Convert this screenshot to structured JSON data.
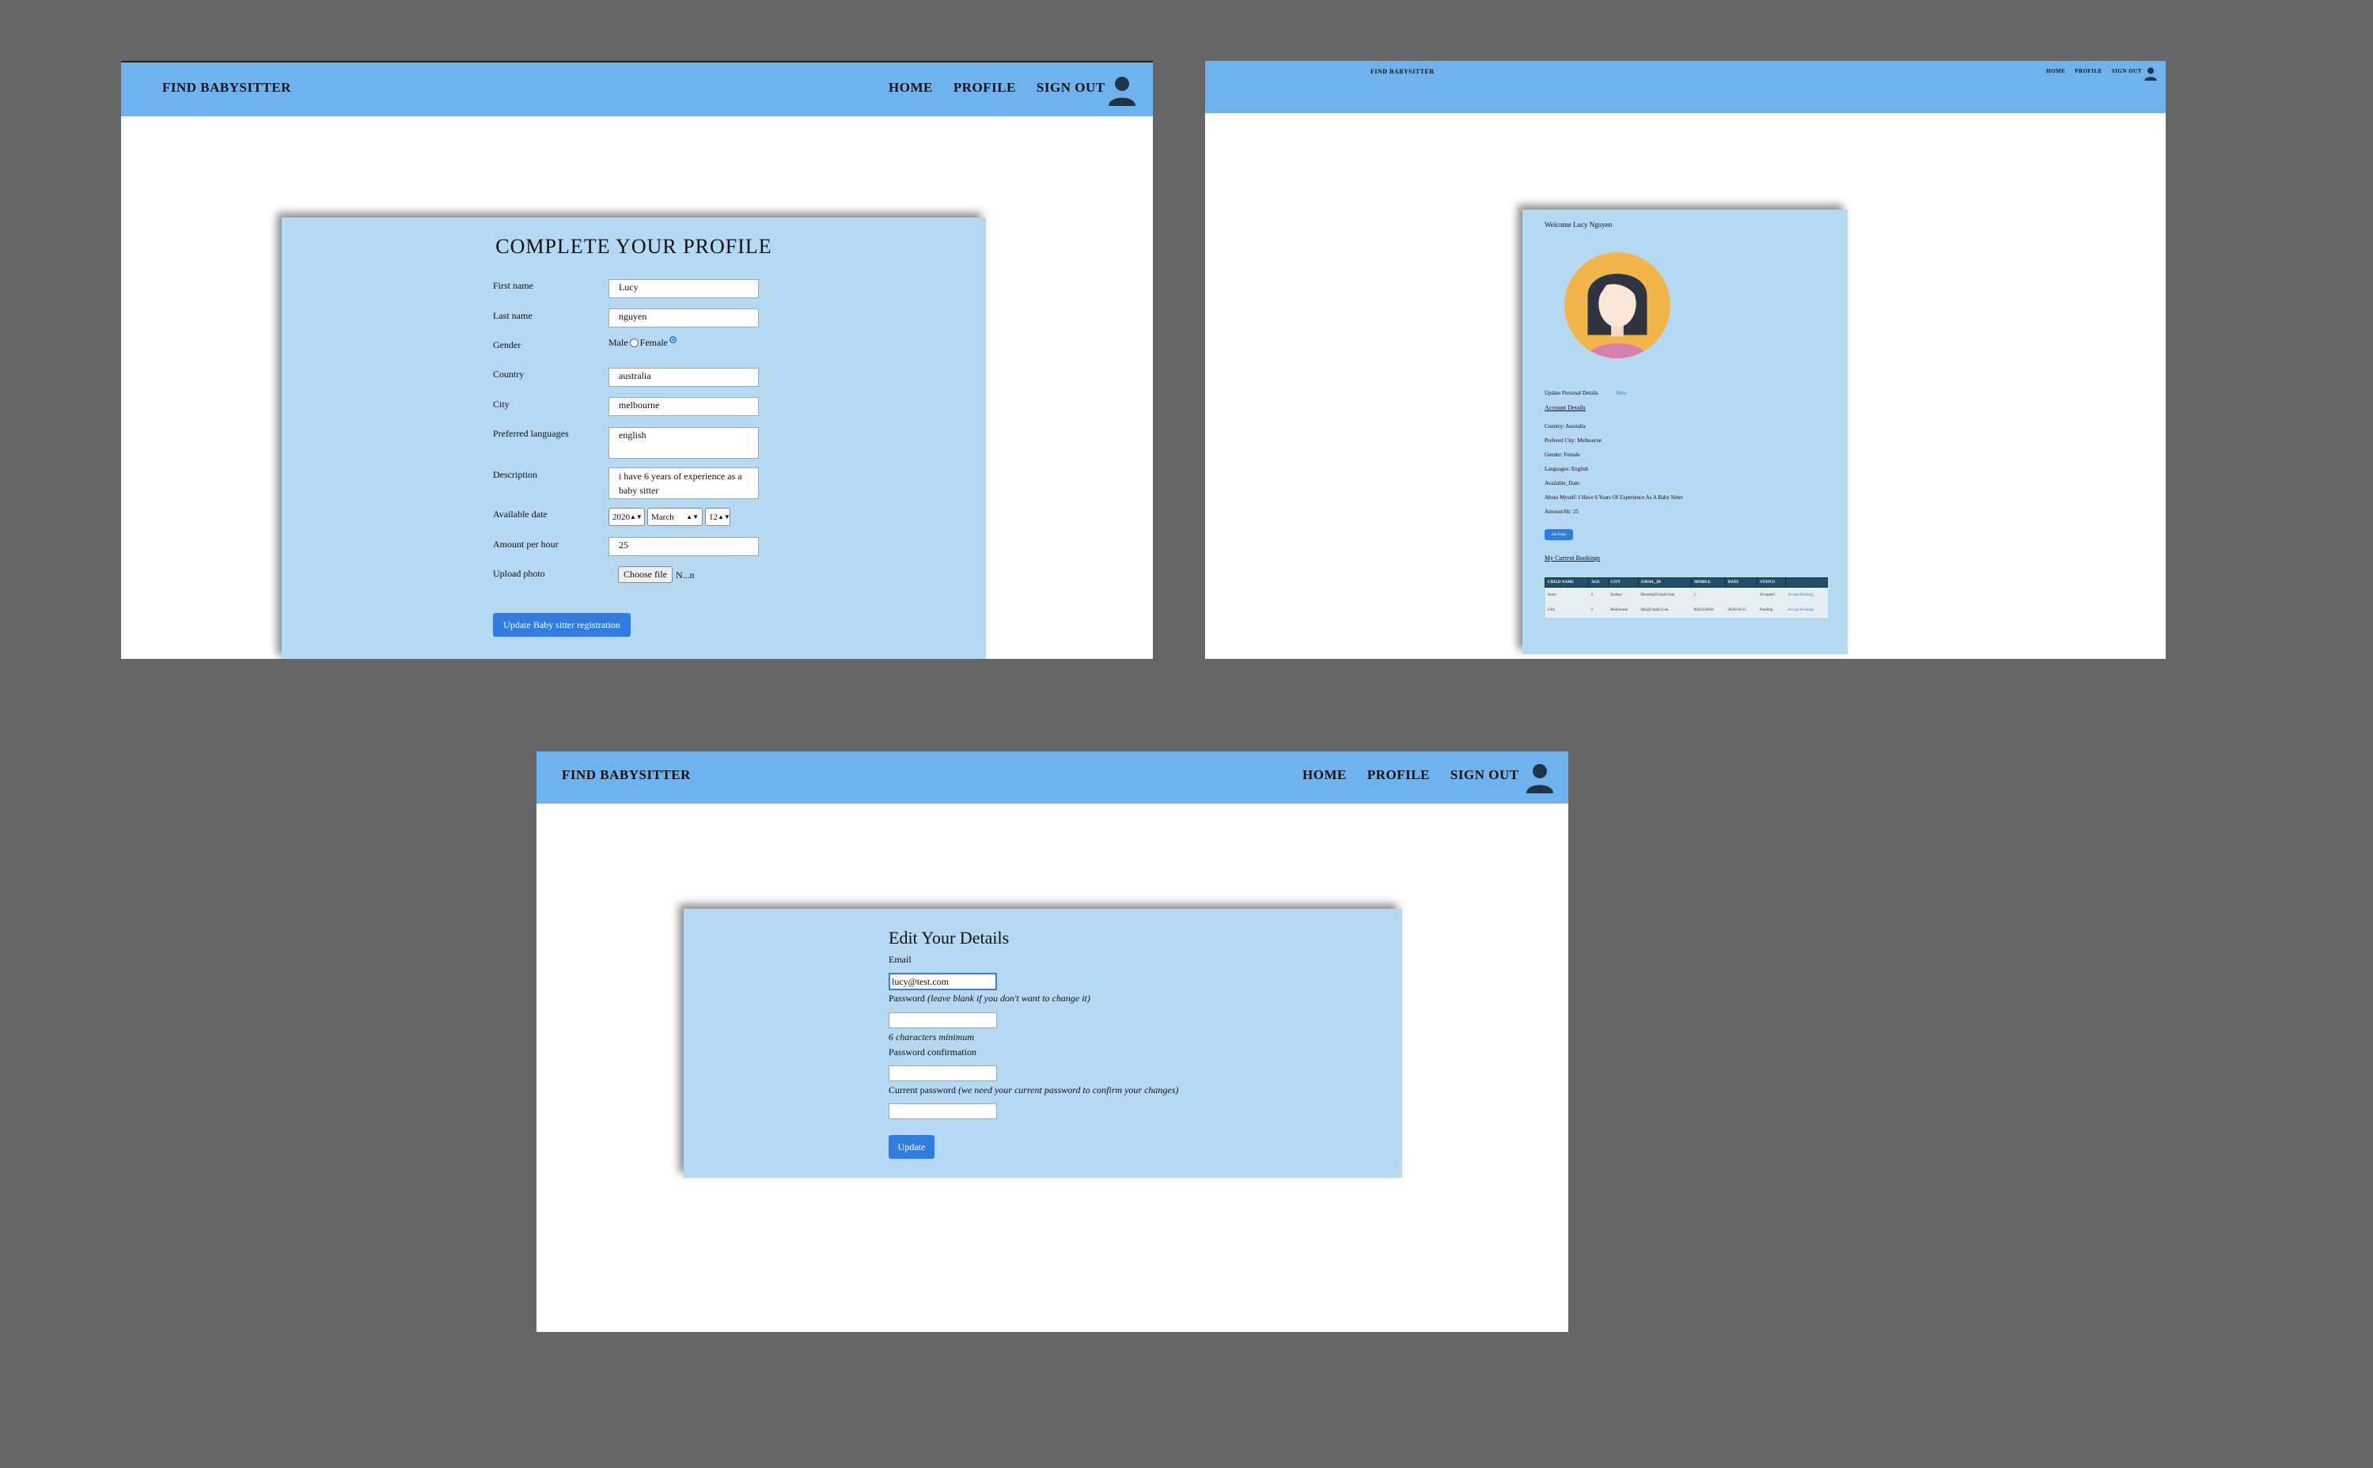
{
  "nav": {
    "brand": "FIND BABYSITTER",
    "home": "HOME",
    "profile": "PROFILE",
    "sign_out": "SIGN OUT"
  },
  "complete_profile": {
    "title": "COMPLETE YOUR PROFILE",
    "first_name_label": "First name",
    "first_name_value": "Lucy",
    "last_name_label": "Last name",
    "last_name_value": "nguyen",
    "gender_label": "Gender",
    "gender_male": "Male",
    "gender_female": "Female",
    "gender_selected": "Female",
    "country_label": "Country",
    "country_value": "australia",
    "city_label": "City",
    "city_value": "melbourne",
    "languages_label": "Preferred languages",
    "languages_value": "english",
    "description_label": "Description",
    "description_value": "i have 6 years of experience as a baby sitter",
    "available_date_label": "Available date",
    "year": "2020",
    "month": "March",
    "day": "12",
    "amount_label": "Amount per hour",
    "amount_value": "25",
    "upload_label": "Upload photo",
    "choose_file": "Choose file",
    "file_status": "N...n",
    "submit": "Update Baby sitter registration"
  },
  "dashboard": {
    "welcome": "Welcome Lucy Nguyen",
    "update_details": "Update Personal Details",
    "update_link": "Here",
    "account_details_title": "Account Details",
    "country": "Country: Australia",
    "preferred_city": "Prefered City: Melbourne",
    "gender": "Gender: Female",
    "languages": "Languages: English",
    "available_date": "Available_Date:",
    "about": "About Myself: I Have 6 Years Of Experience As A Baby Sitter",
    "amount": "Amount/Hr: 25",
    "button": "Job Posts",
    "bookings_title": "My Current Bookings",
    "table": {
      "headers": [
        "CHILD NAME",
        "AGE",
        "CITY",
        "EMAIL_ID",
        "MOBILE",
        "DATE",
        "STATUS",
        ""
      ],
      "rows": [
        [
          "Aurei",
          "4",
          "Sydney",
          "Bboom@Gmail.Com",
          "1",
          "",
          "Accepted",
          "Accept Booking"
        ],
        [
          "Lilly",
          "3",
          "Melbourne",
          "Mo@Gmail.Com",
          "0041234850",
          "2020-04-15",
          "Pending",
          "Accept Booking"
        ]
      ]
    }
  },
  "edit_details": {
    "title": "Edit Your Details",
    "email_label": "Email",
    "email_value": "lucy@test.com",
    "password_label": "Password",
    "password_hint": "(leave blank if you don't want to change it)",
    "password_min": "6 characters minimum",
    "confirm_label": "Password confirmation",
    "current_label": "Current password",
    "current_hint": "(we need your current password to confirm your changes)",
    "submit": "Update"
  }
}
